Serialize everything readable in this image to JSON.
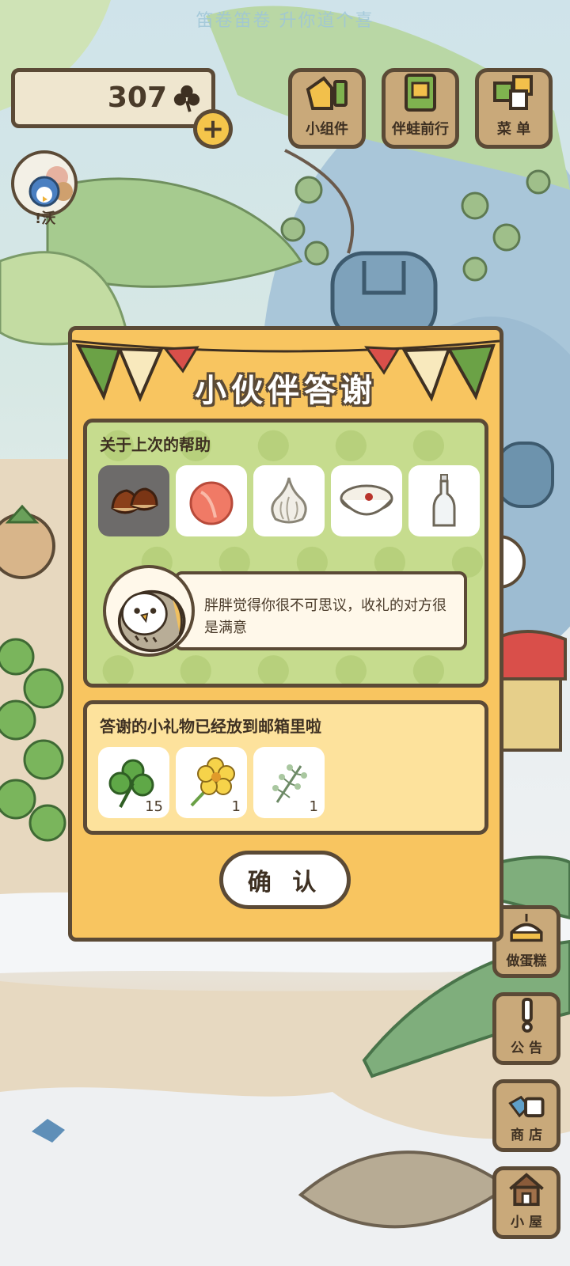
{
  "marquee": "笛卷笛卷 升你道个喜",
  "currency": {
    "amount": "307"
  },
  "avatar": {
    "label": "!沃"
  },
  "top_buttons": [
    {
      "label": "小组件"
    },
    {
      "label": "伴蛙前行"
    },
    {
      "label": "菜 单"
    }
  ],
  "side_buttons": [
    {
      "label": "做蛋糕"
    },
    {
      "label": "公 告"
    },
    {
      "label": "商 店"
    },
    {
      "label": "小 屋"
    }
  ],
  "dialog": {
    "title": "小伙伴答谢",
    "help_section": {
      "title": "关于上次的帮助",
      "items": [
        "chestnut-icon",
        "peach-icon",
        "garlic-icon",
        "porridge-icon",
        "bottle-icon"
      ],
      "message": "胖胖觉得你很不可思议，收礼的对方很是满意"
    },
    "gift_section": {
      "title": "答谢的小礼物已经放到邮箱里啦",
      "gifts": [
        {
          "icon": "clover-icon",
          "count": "15"
        },
        {
          "icon": "flower-icon",
          "count": "1"
        },
        {
          "icon": "herb-icon",
          "count": "1"
        }
      ]
    },
    "confirm_label": "确 认"
  },
  "colors": {
    "dialog": "#f8c560",
    "border": "#5b4a36",
    "help_bg": "#c6dc8e",
    "gift_bg": "#fde29c"
  }
}
